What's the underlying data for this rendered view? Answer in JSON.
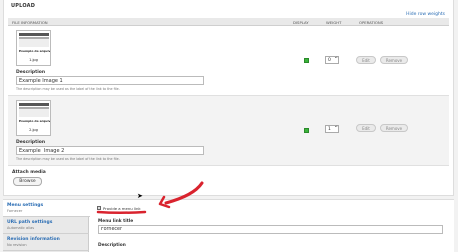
{
  "upload": {
    "title": "UPLOAD",
    "hide_weights": "Hide row weights",
    "columns": {
      "file_info": "FILE INFORMATION",
      "display": "DISPLAY",
      "weight": "WEIGHT",
      "operations": "OPERATIONS"
    },
    "rows": [
      {
        "thumb_title": "Exemplo de arquivo",
        "filename": "1.jpg",
        "description_label": "Description",
        "description_value": "Example Image 1",
        "hint": "The description may be used as the label of the link to the file.",
        "weight": "0",
        "edit": "Edit",
        "remove": "Remove"
      },
      {
        "thumb_title": "Exemplo de arquivo",
        "filename": "2.jpg",
        "description_label": "Description",
        "description_value": "Example  Image 2",
        "hint": "The description may be used as the label of the link to the file.",
        "weight": "1",
        "edit": "Edit",
        "remove": "Remove"
      }
    ],
    "attach_label": "Attach media",
    "browse": "Browse"
  },
  "vertical_tabs": [
    {
      "title": "Menu settings",
      "summary": "Fornecer"
    },
    {
      "title": "URL path settings",
      "summary": "Automatic alias"
    },
    {
      "title": "Revision information",
      "summary": "No revision"
    }
  ],
  "menu_settings": {
    "provide_link_label": "Provide a menu link",
    "link_title_label": "Menu link title",
    "link_title_value": "Fornecer",
    "description_label": "Description"
  },
  "colors": {
    "annotation": "#d9232e",
    "link": "#2a6db4",
    "checked": "#3bb33b"
  }
}
